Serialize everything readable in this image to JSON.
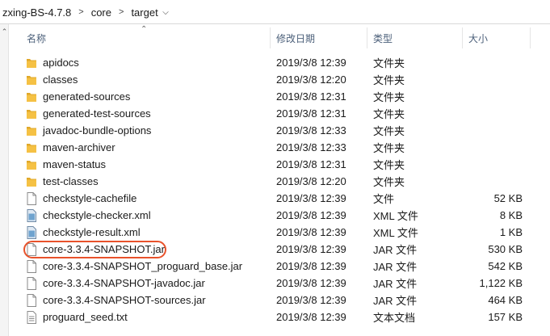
{
  "breadcrumb": {
    "items": [
      "zxing-BS-4.7.8",
      "core",
      "target"
    ],
    "separator": ">"
  },
  "columns": {
    "name": "名称",
    "date": "修改日期",
    "type": "类型",
    "size": "大小"
  },
  "files": [
    {
      "name": "apidocs",
      "date": "2019/3/8 12:39",
      "type": "文件夹",
      "size": "",
      "icon": "folder-icon"
    },
    {
      "name": "classes",
      "date": "2019/3/8 12:20",
      "type": "文件夹",
      "size": "",
      "icon": "folder-icon"
    },
    {
      "name": "generated-sources",
      "date": "2019/3/8 12:31",
      "type": "文件夹",
      "size": "",
      "icon": "folder-icon"
    },
    {
      "name": "generated-test-sources",
      "date": "2019/3/8 12:31",
      "type": "文件夹",
      "size": "",
      "icon": "folder-icon"
    },
    {
      "name": "javadoc-bundle-options",
      "date": "2019/3/8 12:33",
      "type": "文件夹",
      "size": "",
      "icon": "folder-icon"
    },
    {
      "name": "maven-archiver",
      "date": "2019/3/8 12:33",
      "type": "文件夹",
      "size": "",
      "icon": "folder-icon"
    },
    {
      "name": "maven-status",
      "date": "2019/3/8 12:31",
      "type": "文件夹",
      "size": "",
      "icon": "folder-icon"
    },
    {
      "name": "test-classes",
      "date": "2019/3/8 12:20",
      "type": "文件夹",
      "size": "",
      "icon": "folder-icon"
    },
    {
      "name": "checkstyle-cachefile",
      "date": "2019/3/8 12:39",
      "type": "文件",
      "size": "52 KB",
      "icon": "file-icon"
    },
    {
      "name": "checkstyle-checker.xml",
      "date": "2019/3/8 12:39",
      "type": "XML 文件",
      "size": "8 KB",
      "icon": "xml-file-icon"
    },
    {
      "name": "checkstyle-result.xml",
      "date": "2019/3/8 12:39",
      "type": "XML 文件",
      "size": "1 KB",
      "icon": "xml-file-icon"
    },
    {
      "name": "core-3.3.4-SNAPSHOT.jar",
      "date": "2019/3/8 12:39",
      "type": "JAR 文件",
      "size": "530 KB",
      "icon": "file-icon"
    },
    {
      "name": "core-3.3.4-SNAPSHOT_proguard_base.jar",
      "date": "2019/3/8 12:39",
      "type": "JAR 文件",
      "size": "542 KB",
      "icon": "file-icon"
    },
    {
      "name": "core-3.3.4-SNAPSHOT-javadoc.jar",
      "date": "2019/3/8 12:39",
      "type": "JAR 文件",
      "size": "1,122 KB",
      "icon": "file-icon"
    },
    {
      "name": "core-3.3.4-SNAPSHOT-sources.jar",
      "date": "2019/3/8 12:39",
      "type": "JAR 文件",
      "size": "464 KB",
      "icon": "file-icon"
    },
    {
      "name": "proguard_seed.txt",
      "date": "2019/3/8 12:39",
      "type": "文本文档",
      "size": "157 KB",
      "icon": "text-file-icon"
    }
  ],
  "colors": {
    "folder": "#f5c144",
    "folder_dark": "#e0a82a",
    "highlight": "#e8522b",
    "header_text": "#4c607a"
  }
}
